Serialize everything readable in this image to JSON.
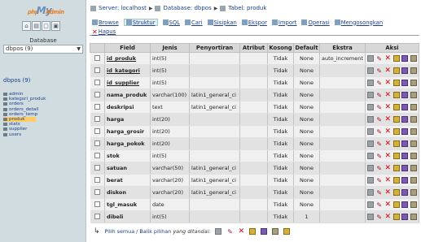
{
  "sidebar": {
    "logo_php": "php",
    "logo_my": "My",
    "logo_admin": "Admin",
    "database_label": "Database",
    "database_selected": "dbpos (9)",
    "db_heading": "dbpos (9)",
    "tables": [
      "admin",
      "kategori_produk",
      "orders",
      "orders_detail",
      "orders_temp",
      "produk",
      "stats",
      "supplier",
      "users"
    ],
    "selected_table": "produk"
  },
  "breadcrumb": {
    "server": "Server: localhost",
    "database": "Database: dbpos",
    "table": "Tabel: produk"
  },
  "tabs": [
    {
      "label": "Browse",
      "active": false,
      "danger": false
    },
    {
      "label": "Struktur",
      "active": true,
      "danger": false
    },
    {
      "label": "SQL",
      "active": false,
      "danger": false
    },
    {
      "label": "Cari",
      "active": false,
      "danger": false
    },
    {
      "label": "Sisipkan",
      "active": false,
      "danger": false
    },
    {
      "label": "Ekspor",
      "active": false,
      "danger": false
    },
    {
      "label": "Import",
      "active": false,
      "danger": false
    },
    {
      "label": "Operasi",
      "active": false,
      "danger": false
    },
    {
      "label": "Mengosongkan",
      "active": false,
      "danger": false
    },
    {
      "label": "Hapus",
      "active": false,
      "danger": true
    }
  ],
  "table": {
    "headers": {
      "field": "Field",
      "jenis": "Jenis",
      "penyortiran": "Penyortiran",
      "atribut": "Atribut",
      "kosong": "Kosong",
      "default": "Default",
      "ekstra": "Ekstra",
      "aksi": "Aksi"
    },
    "rows": [
      {
        "field": "id_produk",
        "jenis": "int(5)",
        "penyortiran": "",
        "atribut": "",
        "kosong": "Tidak",
        "default": "None",
        "ekstra": "auto_increment",
        "primary": true
      },
      {
        "field": "id_kategori",
        "jenis": "int(5)",
        "penyortiran": "",
        "atribut": "",
        "kosong": "Tidak",
        "default": "None",
        "ekstra": "",
        "primary": false
      },
      {
        "field": "id_supplier",
        "jenis": "int(5)",
        "penyortiran": "",
        "atribut": "",
        "kosong": "Tidak",
        "default": "None",
        "ekstra": "",
        "primary": false
      },
      {
        "field": "nama_produk",
        "jenis": "varchar(100)",
        "penyortiran": "latin1_general_ci",
        "atribut": "",
        "kosong": "Tidak",
        "default": "None",
        "ekstra": "",
        "primary": false
      },
      {
        "field": "deskripsi",
        "jenis": "text",
        "penyortiran": "latin1_general_ci",
        "atribut": "",
        "kosong": "Tidak",
        "default": "None",
        "ekstra": "",
        "primary": false
      },
      {
        "field": "harga",
        "jenis": "int(20)",
        "penyortiran": "",
        "atribut": "",
        "kosong": "Tidak",
        "default": "None",
        "ekstra": "",
        "primary": false
      },
      {
        "field": "harga_grosir",
        "jenis": "int(20)",
        "penyortiran": "",
        "atribut": "",
        "kosong": "Tidak",
        "default": "None",
        "ekstra": "",
        "primary": false
      },
      {
        "field": "harga_pokok",
        "jenis": "int(20)",
        "penyortiran": "",
        "atribut": "",
        "kosong": "Tidak",
        "default": "None",
        "ekstra": "",
        "primary": false
      },
      {
        "field": "stok",
        "jenis": "int(5)",
        "penyortiran": "",
        "atribut": "",
        "kosong": "Tidak",
        "default": "None",
        "ekstra": "",
        "primary": false
      },
      {
        "field": "satuan",
        "jenis": "varchar(50)",
        "penyortiran": "latin1_general_ci",
        "atribut": "",
        "kosong": "Tidak",
        "default": "None",
        "ekstra": "",
        "primary": false
      },
      {
        "field": "berat",
        "jenis": "varchar(20)",
        "penyortiran": "latin1_general_ci",
        "atribut": "",
        "kosong": "Tidak",
        "default": "None",
        "ekstra": "",
        "primary": false
      },
      {
        "field": "diskon",
        "jenis": "varchar(20)",
        "penyortiran": "latin1_general_ci",
        "atribut": "",
        "kosong": "Tidak",
        "default": "None",
        "ekstra": "",
        "primary": false
      },
      {
        "field": "tgl_masuk",
        "jenis": "date",
        "penyortiran": "",
        "atribut": "",
        "kosong": "Tidak",
        "default": "None",
        "ekstra": "",
        "primary": false
      },
      {
        "field": "dibeli",
        "jenis": "int(5)",
        "penyortiran": "",
        "atribut": "",
        "kosong": "Tidak",
        "default": "1",
        "ekstra": "",
        "primary": false
      }
    ]
  },
  "footer": {
    "select_all_text": "Pilih semua / Balik pilihan",
    "marked_text": "yang ditandai:"
  },
  "colors": {
    "link": "#1d3f8c",
    "logo_orange": "#ec7f1d",
    "logo_blue": "#6b8dbd",
    "selected_bg": "#ffcc66",
    "header_bg": "#d8d8d8"
  },
  "icons": {
    "browse": "browse-icon",
    "edit": "pencil-icon",
    "drop": "delete-x-icon",
    "primary": "primary-key-icon",
    "unique": "unique-icon",
    "index": "index-icon"
  }
}
